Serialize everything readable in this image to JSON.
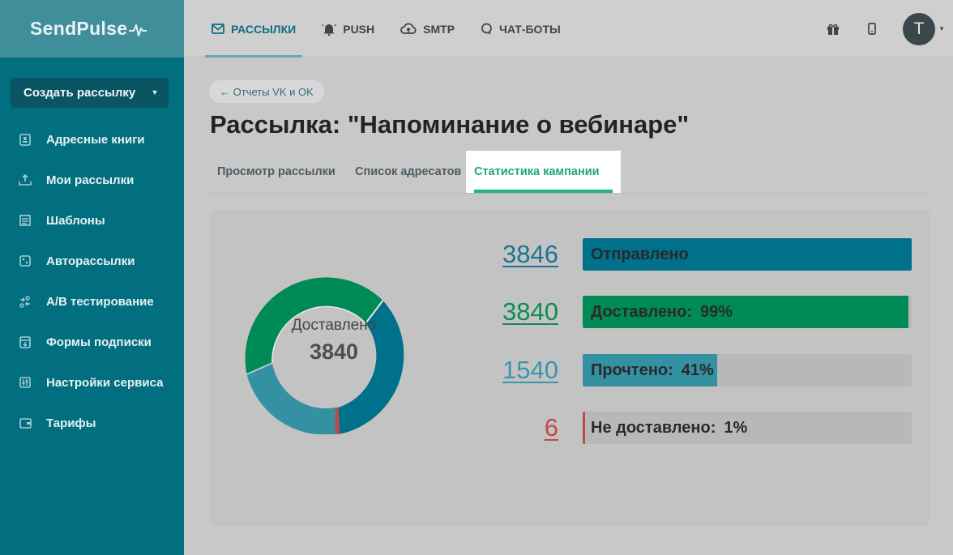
{
  "brand": {
    "name": "SendPulse"
  },
  "sidebar": {
    "create_label": "Создать рассылку",
    "items": [
      {
        "label": "Адресные книги",
        "icon": "address-book-icon"
      },
      {
        "label": "Мои рассылки",
        "icon": "campaigns-icon"
      },
      {
        "label": "Шаблоны",
        "icon": "templates-icon"
      },
      {
        "label": "Авторассылки",
        "icon": "automation-icon"
      },
      {
        "label": "A/B тестирование",
        "icon": "ab-test-icon"
      },
      {
        "label": "Формы подписки",
        "icon": "form-icon"
      },
      {
        "label": "Настройки сервиса",
        "icon": "settings-sliders-icon"
      },
      {
        "label": "Тарифы",
        "icon": "wallet-icon"
      }
    ]
  },
  "topnav": {
    "items": [
      {
        "label": "РАССЫЛКИ",
        "icon": "mail-icon",
        "active": true
      },
      {
        "label": "PUSH",
        "icon": "bell-icon",
        "active": false
      },
      {
        "label": "SMTP",
        "icon": "cloud-upload-icon",
        "active": false
      },
      {
        "label": "ЧАТ-БОТЫ",
        "icon": "chat-bubble-icon",
        "active": false
      }
    ],
    "avatar_letter": "T"
  },
  "page": {
    "back_label": "← Отчеты VK и OK",
    "title": "Рассылка: \"Напоминание о вебинаре\"",
    "tabs": [
      {
        "label": "Просмотр рассылки",
        "active": false
      },
      {
        "label": "Список адресатов",
        "active": false
      },
      {
        "label": "Статистика кампании",
        "active": true
      }
    ]
  },
  "stats": {
    "donut": {
      "label": "Доставлено",
      "value": "3840"
    },
    "rows": [
      {
        "number": "3846",
        "label": "Отправлено",
        "percent": "",
        "fill": 1.0,
        "color": "#00718a",
        "number_color": "#1d7393"
      },
      {
        "number": "3840",
        "label": "Доставлено:",
        "percent": "99%",
        "fill": 0.99,
        "color": "#008b56",
        "number_color": "#0f8b57"
      },
      {
        "number": "1540",
        "label": "Прочтено:",
        "percent": "41%",
        "fill": 0.41,
        "color": "#3391a2",
        "number_color": "#3a95ae"
      },
      {
        "number": "6",
        "label": "Не доставлено:",
        "percent": "1%",
        "fill": 0.005,
        "color": "#bf4a4a",
        "number_color": "#c44848"
      }
    ]
  },
  "colors": {
    "sidebar": "#026f80",
    "accent": "#1fb57f",
    "delivered": "#008b56",
    "sent": "#00718a",
    "read": "#3391a2",
    "failed": "#bf4a4a"
  }
}
